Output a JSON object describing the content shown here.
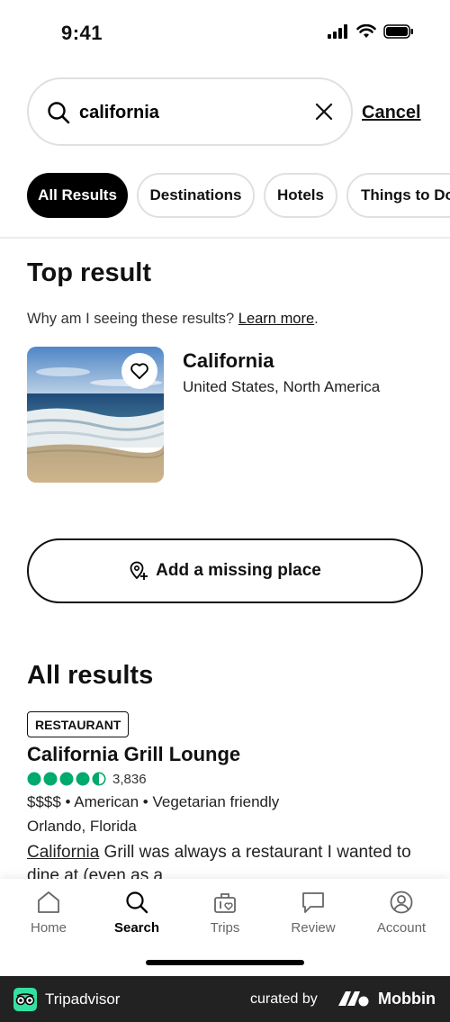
{
  "status": {
    "time": "9:41"
  },
  "search": {
    "query": "california",
    "cancel_label": "Cancel"
  },
  "chips": [
    {
      "label": "All Results",
      "active": true
    },
    {
      "label": "Destinations",
      "active": false
    },
    {
      "label": "Hotels",
      "active": false
    },
    {
      "label": "Things to Do",
      "active": false
    }
  ],
  "top_result": {
    "heading": "Top result",
    "why_text": "Why am I seeing these results? ",
    "learn_more": "Learn more",
    "why_suffix": ".",
    "name": "California",
    "region": "United States, North America"
  },
  "add_place": {
    "label": "Add a missing place"
  },
  "all_results": {
    "heading": "All results",
    "items": [
      {
        "badge": "RESTAURANT",
        "name": "California Grill Lounge",
        "rating": 4.5,
        "review_count": "3,836",
        "meta": "$$$$ • American • Vegetarian friendly",
        "location": "Orlando, Florida",
        "snippet_highlight": "California",
        "snippet_rest": " Grill was always a restaurant I wanted to dine at (even as a"
      }
    ]
  },
  "tabs": [
    {
      "label": "Home",
      "icon": "home-icon",
      "active": false
    },
    {
      "label": "Search",
      "icon": "search-icon",
      "active": true
    },
    {
      "label": "Trips",
      "icon": "suitcase-icon",
      "active": false
    },
    {
      "label": "Review",
      "icon": "review-icon",
      "active": false
    },
    {
      "label": "Account",
      "icon": "account-icon",
      "active": false
    }
  ],
  "footer": {
    "brand": "Tripadvisor",
    "curated_by": "curated by",
    "mobbin": "Mobbin"
  },
  "colors": {
    "rating_green": "#00aa6c",
    "chip_active": "#000000",
    "footer_bg": "#222222"
  }
}
